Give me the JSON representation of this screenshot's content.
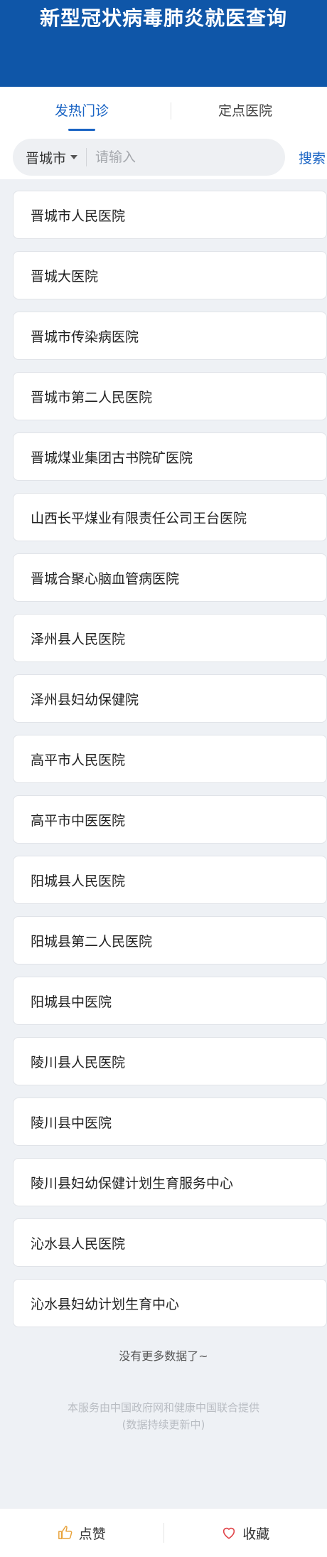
{
  "header": {
    "title": "新型冠状病毒肺炎就医查询"
  },
  "tabs": [
    {
      "label": "发热门诊",
      "active": true
    },
    {
      "label": "定点医院",
      "active": false
    }
  ],
  "search": {
    "city": "晋城市",
    "placeholder": "请输入",
    "value": "",
    "button_label": "搜索"
  },
  "hospitals": [
    "晋城市人民医院",
    "晋城大医院",
    "晋城市传染病医院",
    "晋城市第二人民医院",
    "晋城煤业集团古书院矿医院",
    "山西长平煤业有限责任公司王台医院",
    "晋城合聚心脑血管病医院",
    "泽州县人民医院",
    "泽州县妇幼保健院",
    "高平市人民医院",
    "高平市中医医院",
    "阳城县人民医院",
    "阳城县第二人民医院",
    "阳城县中医院",
    "陵川县人民医院",
    "陵川县中医院",
    "陵川县妇幼保健计划生育服务中心",
    "沁水县人民医院",
    "沁水县妇幼计划生育中心"
  ],
  "list_end_text": "没有更多数据了~",
  "footnote": {
    "line1": "本服务由中国政府网和健康中国联合提供",
    "line2": "(数据持续更新中)"
  },
  "bottom_bar": {
    "like_label": "点赞",
    "favorite_label": "收藏"
  },
  "colors": {
    "header_bg": "#0f56a8",
    "accent": "#1a64c4",
    "like_icon": "#e8a23a",
    "favorite_icon": "#e0454a"
  },
  "icons": {
    "like": "thumbs-up-icon",
    "favorite": "heart-icon",
    "city_dropdown": "caret-down-icon"
  }
}
